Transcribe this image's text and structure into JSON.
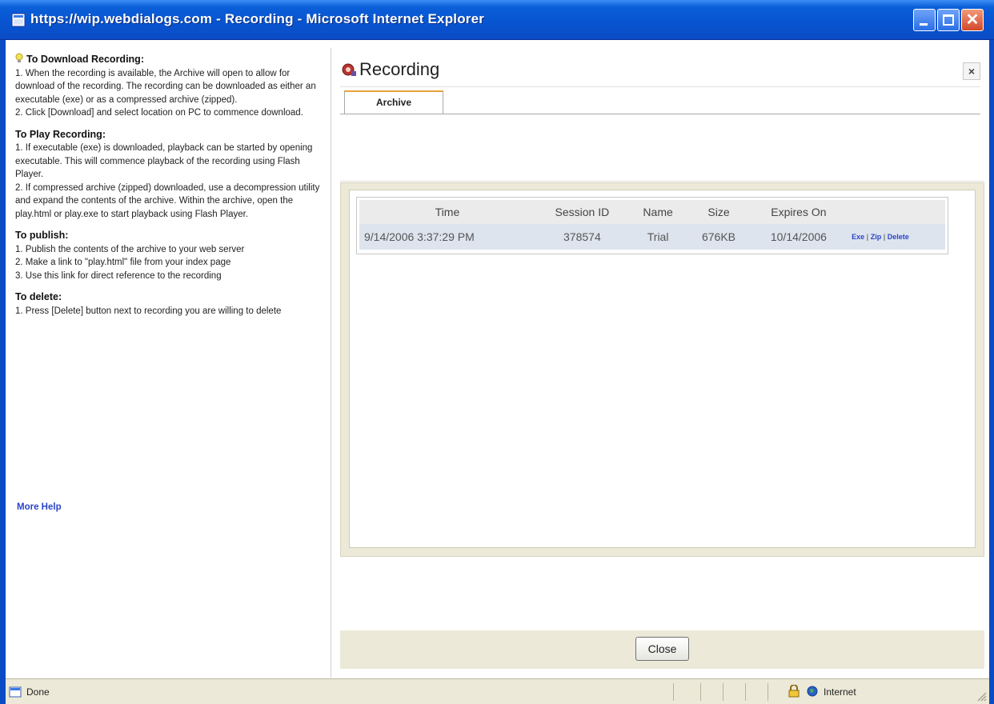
{
  "window": {
    "title": "https://wip.webdialogs.com - Recording - Microsoft Internet Explorer",
    "colors": {
      "titlebar": "#0854d0",
      "frame": "#0a4cc4",
      "panel": "#ece9d8"
    }
  },
  "help": {
    "sections": [
      {
        "title": "To Download Recording:",
        "lines": [
          "1. When the recording is available, the Archive will open to allow for download of the recording. The recording can be downloaded as either an executable (exe) or as a compressed archive (zipped).",
          "2. Click [Download] and select location on PC to commence download."
        ]
      },
      {
        "title": "To Play Recording:",
        "lines": [
          "1. If executable (exe) is downloaded, playback can be started by opening executable. This will commence playback of the recording using Flash Player.",
          "2. If compressed archive (zipped) downloaded, use a decompression utility and expand the contents of the archive. Within the archive, open the play.html or play.exe to start playback using Flash Player."
        ]
      },
      {
        "title": "To publish:",
        "lines": [
          "1. Publish the contents of the archive to your web server",
          "2. Make a link to \"play.html\" file from your index page",
          "3. Use this link for direct reference to the recording"
        ]
      },
      {
        "title": "To delete:",
        "lines": [
          "1. Press [Delete] button next to recording you are willing to delete"
        ]
      }
    ],
    "more_help": "More Help",
    "icon": "lightbulb-icon"
  },
  "main": {
    "title": "Recording",
    "icon": "recording-icon",
    "close_x": "×",
    "tab": "Archive",
    "table": {
      "headers": [
        "Time",
        "Session ID",
        "Name",
        "Size",
        "Expires On",
        ""
      ],
      "rows": [
        {
          "time": "9/14/2006 3:37:29 PM",
          "session_id": "378574",
          "name": "Trial",
          "size": "676KB",
          "expires": "10/14/2006",
          "actions": [
            "Exe",
            "Zip",
            "Delete"
          ]
        }
      ]
    },
    "close_button": "Close"
  },
  "statusbar": {
    "status": "Done",
    "zone": "Internet",
    "icons": [
      "page-icon",
      "lock-icon",
      "globe-icon"
    ]
  }
}
